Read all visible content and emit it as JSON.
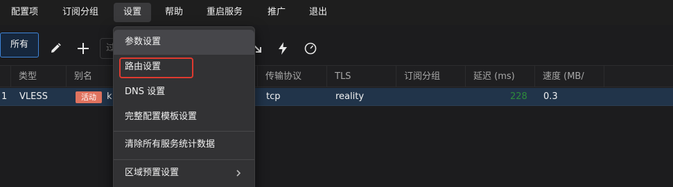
{
  "menubar": {
    "items": [
      "配置项",
      "订阅分组",
      "设置",
      "帮助",
      "重启服务",
      "推广",
      "退出"
    ]
  },
  "toolbar": {
    "all_label": "所有",
    "search_placeholder": "过"
  },
  "table": {
    "columns": [
      "类型",
      "别名",
      "传输协议",
      "TLS",
      "订阅分组",
      "延迟 (ms)",
      "速度 (MB/"
    ],
    "rows": [
      {
        "index": "1",
        "type": "VLESS",
        "status_badge": "活动",
        "alias": "k",
        "transport": "tcp",
        "tls": "reality",
        "group": "",
        "latency": "228",
        "speed": "0.3"
      }
    ]
  },
  "dropdown": {
    "items": [
      "参数设置",
      "路由设置",
      "DNS 设置",
      "完整配置模板设置",
      "清除所有服务统计数据",
      "区域预置设置"
    ]
  },
  "colors": {
    "accent": "#3f85d9",
    "highlight": "#e03a2f",
    "badge": "#e0735f",
    "latency": "#2e8b3a",
    "selected_row": "#21344a"
  }
}
